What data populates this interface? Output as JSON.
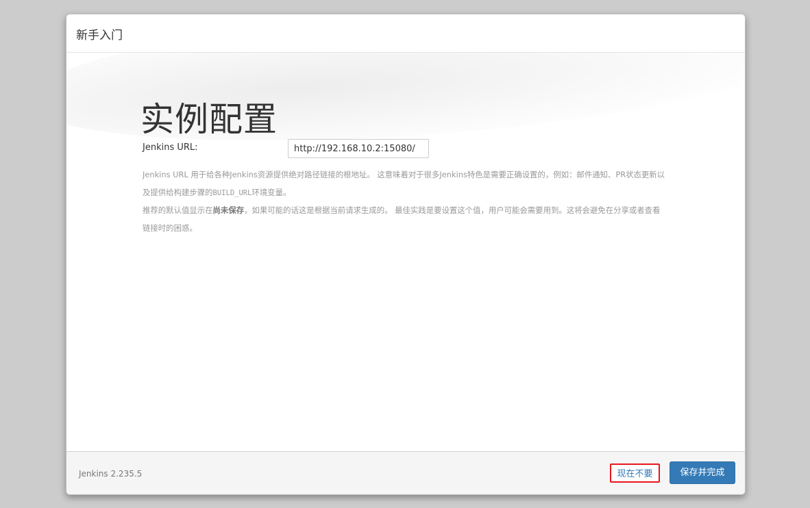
{
  "dialog": {
    "title": "新手入门"
  },
  "main": {
    "heading": "实例配置",
    "url_label": "Jenkins URL:",
    "url_value": "http://192.168.10.2:15080/",
    "help": {
      "p1_a": "Jenkins URL 用于给各种Jenkins资源提供绝对路径链接的根地址。 这意味着对于很多Jenkins特色是需要正确设置的，例如：邮件通知、PR状态更新以及提供给构建步骤的",
      "p1_code": "BUILD_URL",
      "p1_b": "环境变量。",
      "p2_a": "推荐的默认值显示在",
      "p2_strong": "尚未保存",
      "p2_b": "，如果可能的话这是根据当前请求生成的。 最佳实践是要设置这个值，用户可能会需要用到。这将会避免在分享或者查看链接时的困惑。"
    }
  },
  "footer": {
    "version": "Jenkins 2.235.5",
    "skip_label": "现在不要",
    "save_label": "保存并完成"
  },
  "colors": {
    "primary": "#337ab7",
    "highlight_border": "#e8161c",
    "backdrop": "#cccccc"
  }
}
